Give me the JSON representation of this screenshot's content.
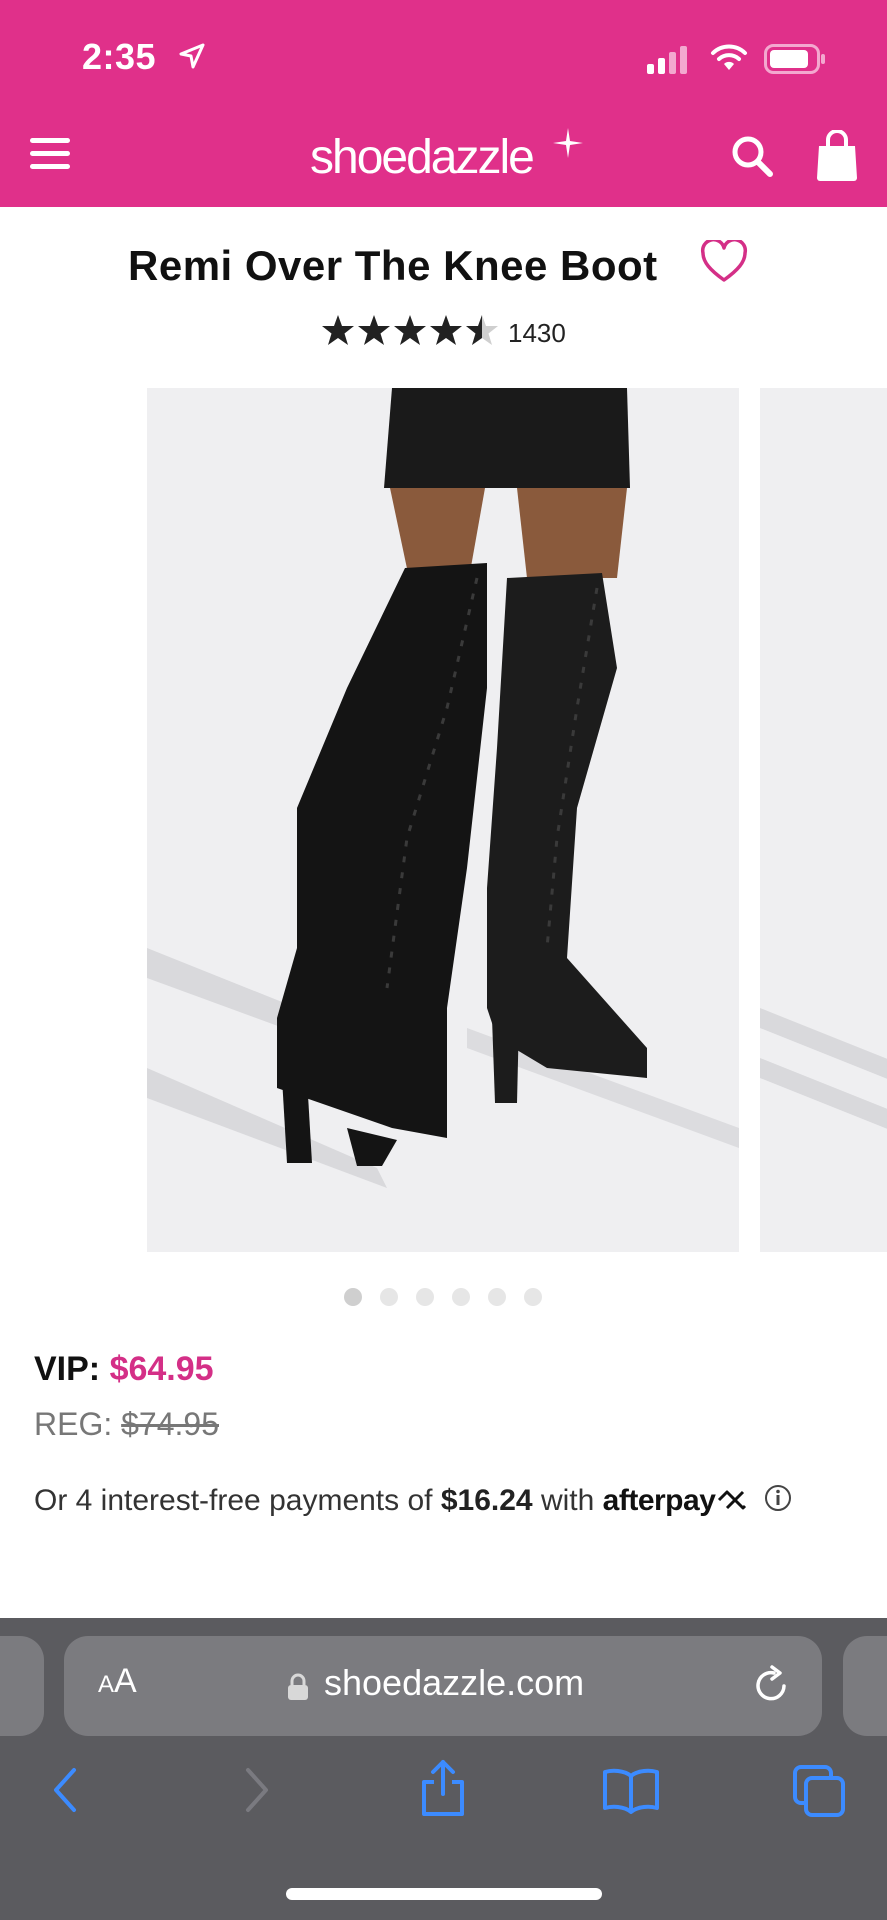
{
  "status_bar": {
    "time": "2:35",
    "icons": [
      "location-arrow-icon",
      "cellular-signal-icon",
      "wifi-icon",
      "battery-icon"
    ]
  },
  "header": {
    "logo_text": "shoedazzle",
    "background_color": "#e0308a",
    "icons": [
      "menu-icon",
      "search-icon",
      "shopping-bag-icon"
    ]
  },
  "product": {
    "title": "Remi Over The Knee Boot",
    "rating_stars": 4.5,
    "rating_max": 5,
    "review_count": "1430",
    "image_count": 6,
    "active_image_index": 0
  },
  "pricing": {
    "vip_label": "VIP:",
    "vip_price": "$64.95",
    "reg_label": "REG:",
    "reg_price": "$74.95",
    "afterpay_prefix": "Or 4 interest-free payments of",
    "afterpay_amount": "$16.24",
    "afterpay_with": "with",
    "afterpay_brand": "afterpay",
    "accent_color": "#d42f87"
  },
  "browser": {
    "aa_label": "A",
    "aa_label_large": "A",
    "url": "shoedazzle.com",
    "nav_icons": [
      "back-icon",
      "forward-icon",
      "share-icon",
      "bookmarks-icon",
      "tabs-icon"
    ]
  }
}
